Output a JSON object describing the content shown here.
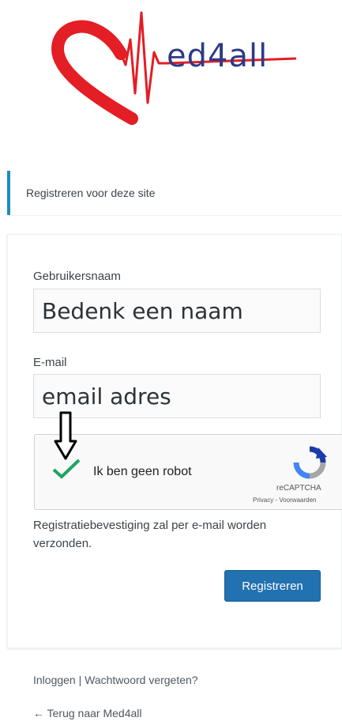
{
  "logo": {
    "text": "ed4all",
    "brand_color": "#e31e24",
    "text_color": "#2d3a86"
  },
  "message": {
    "text": "Registreren voor deze site",
    "accent_color": "#1e8cbe"
  },
  "form": {
    "username_label": "Gebruikersnaam",
    "username_value": "Bedenk een naam",
    "email_label": "E-mail",
    "email_value": "email adres",
    "captcha": {
      "label": "Ik ben geen robot",
      "brand": "reCAPTCHA",
      "links": "Privacy - Voorwaarden",
      "checked": true
    },
    "confirm_text": "Registratiebevestiging zal per e-mail worden verzonden.",
    "submit_label": "Registreren",
    "submit_color": "#2271b1"
  },
  "nav": {
    "login": "Inloggen",
    "separator": "|",
    "lost_password": "Wachtwoord vergeten?",
    "back": "← Terug naar Med4all"
  }
}
